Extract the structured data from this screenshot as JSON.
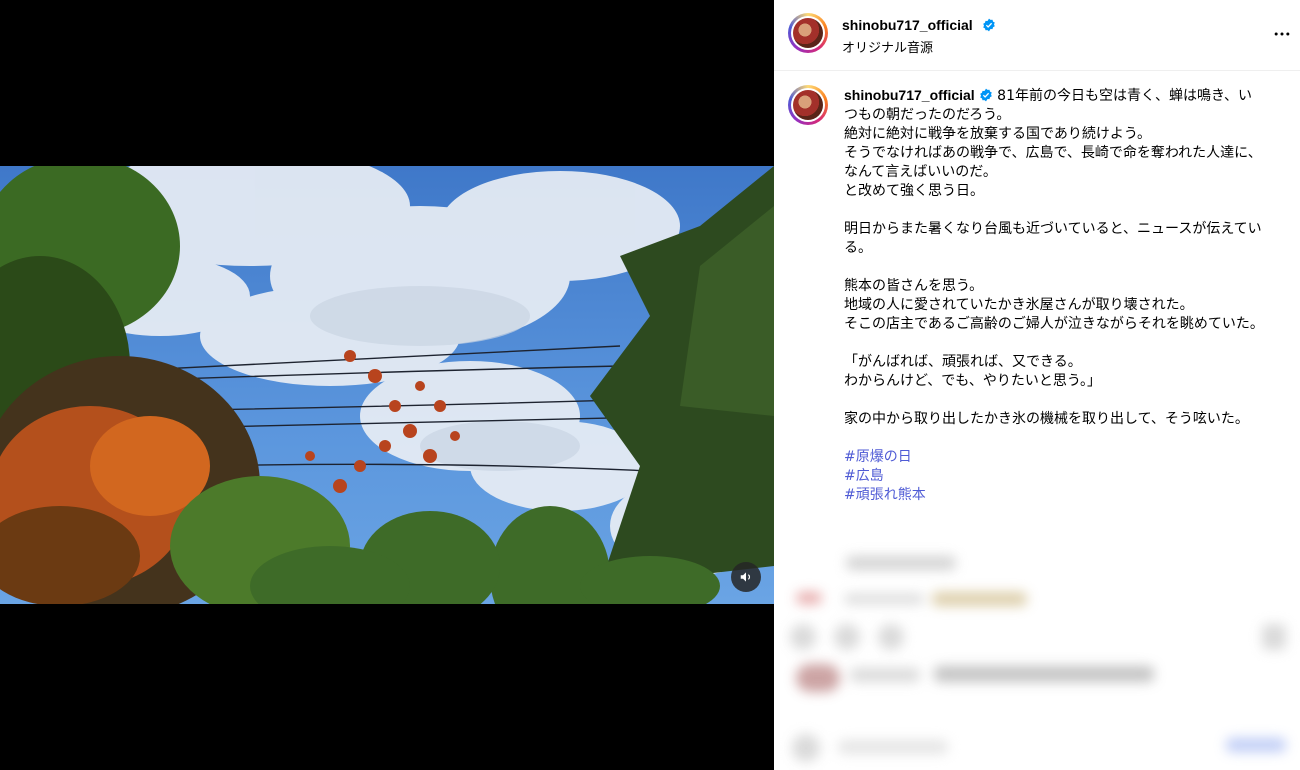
{
  "post": {
    "username": "shinobu717_official",
    "audio_label": "オリジナル音源"
  },
  "caption": {
    "username": "shinobu717_official",
    "lines": [
      "81年前の今日も空は青く、蝉は鳴き、いつもの朝だったのだろう。",
      "絶対に絶対に戦争を放棄する国であり続けよう。",
      "そうでなければあの戦争で、広島で、長崎で命を奪われた人達に、なんて言えばいいのだ。",
      "と改めて強く思う日。",
      "",
      "明日からまた暑くなり台風も近づいていると、ニュースが伝えている。",
      "",
      "熊本の皆さんを思う。",
      "地域の人に愛されていたかき氷屋さんが取り壊された。",
      "そこの店主であるご高齢のご婦人が泣きながらそれを眺めていた。",
      "",
      "「がんばれば、頑張れば、又できる。",
      "わからんけど、でも、やりたいと思う。」",
      "",
      "家の中から取り出したかき氷の機械を取り出して、そう呟いた。"
    ],
    "hashtags": [
      "#原爆の日",
      "#広島",
      "#頑張れ熊本"
    ]
  },
  "icons": {
    "verified": "verified-badge-icon",
    "more": "more-options-icon",
    "sound": "speaker-icon"
  },
  "colors": {
    "verified": "#0095f6",
    "hashtag": "#4f5bd5"
  }
}
